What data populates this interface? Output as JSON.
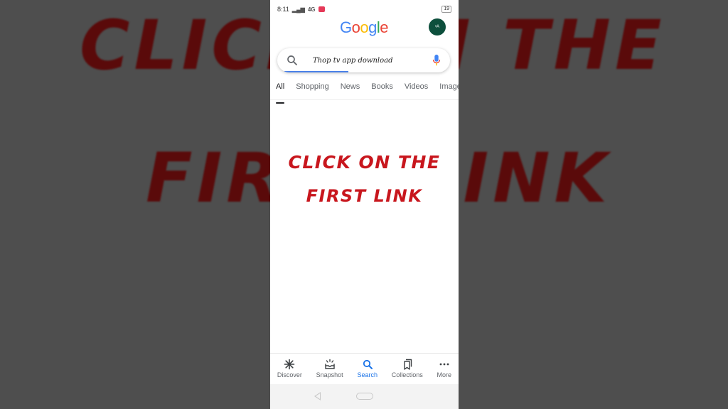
{
  "background_overlay": {
    "line1": "CLICK ON THE",
    "line2": "FIRST LINK"
  },
  "status_bar": {
    "time": "8:11",
    "signal": "4G",
    "battery": "19"
  },
  "header": {
    "logo_letters": [
      {
        "char": "G",
        "color": "#4285F4"
      },
      {
        "char": "o",
        "color": "#EA4335"
      },
      {
        "char": "o",
        "color": "#FBBC05"
      },
      {
        "char": "g",
        "color": "#4285F4"
      },
      {
        "char": "l",
        "color": "#34A853"
      },
      {
        "char": "e",
        "color": "#EA4335"
      }
    ],
    "avatar_text": "•A"
  },
  "search": {
    "value": "Thop tv app download",
    "loading_progress_percent": 37
  },
  "tabs": [
    {
      "label": "All",
      "active": true
    },
    {
      "label": "Shopping",
      "active": false
    },
    {
      "label": "News",
      "active": false
    },
    {
      "label": "Books",
      "active": false
    },
    {
      "label": "Videos",
      "active": false
    },
    {
      "label": "Images",
      "active": false
    }
  ],
  "overlay": {
    "line1": "CLICK ON THE",
    "line2": "FIRST LINK",
    "color": "#c8161d"
  },
  "bottom_nav": [
    {
      "label": "Discover",
      "icon": "asterisk-icon",
      "active": false
    },
    {
      "label": "Snapshot",
      "icon": "snapshot-icon",
      "active": false
    },
    {
      "label": "Search",
      "icon": "search-icon",
      "active": true
    },
    {
      "label": "Collections",
      "icon": "collections-icon",
      "active": false
    },
    {
      "label": "More",
      "icon": "more-dots-icon",
      "active": false
    }
  ]
}
